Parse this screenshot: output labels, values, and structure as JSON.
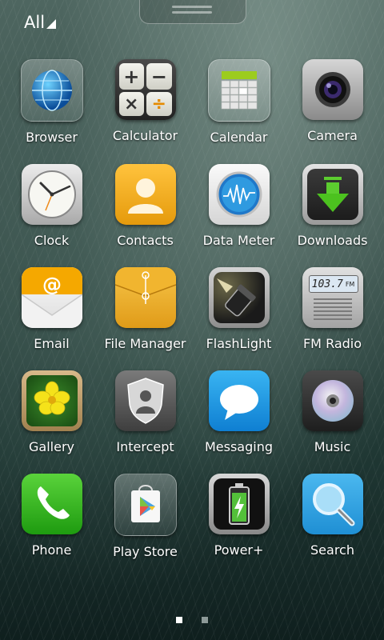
{
  "header": {
    "filter_label": "All"
  },
  "apps": [
    {
      "label": "Browser",
      "icon": "browser-globe-icon"
    },
    {
      "label": "Calculator",
      "icon": "calculator-icon"
    },
    {
      "label": "Calendar",
      "icon": "calendar-icon"
    },
    {
      "label": "Camera",
      "icon": "camera-icon"
    },
    {
      "label": "Clock",
      "icon": "clock-icon"
    },
    {
      "label": "Contacts",
      "icon": "contacts-icon"
    },
    {
      "label": "Data Meter",
      "icon": "data-meter-icon"
    },
    {
      "label": "Downloads",
      "icon": "downloads-icon"
    },
    {
      "label": "Email",
      "icon": "email-icon"
    },
    {
      "label": "File Manager",
      "icon": "file-manager-icon"
    },
    {
      "label": "FlashLight",
      "icon": "flashlight-icon"
    },
    {
      "label": "FM Radio",
      "icon": "fm-radio-icon"
    },
    {
      "label": "Gallery",
      "icon": "gallery-icon"
    },
    {
      "label": "Intercept",
      "icon": "intercept-icon"
    },
    {
      "label": "Messaging",
      "icon": "messaging-icon"
    },
    {
      "label": "Music",
      "icon": "music-icon"
    },
    {
      "label": "Phone",
      "icon": "phone-icon"
    },
    {
      "label": "Play Store",
      "icon": "play-store-icon"
    },
    {
      "label": "Power+",
      "icon": "power-plus-icon"
    },
    {
      "label": "Search",
      "icon": "search-icon"
    }
  ],
  "calculator": {
    "plus": "+",
    "minus": "−",
    "times": "×",
    "divide": "÷"
  },
  "email_symbol": "@",
  "radio_freq": "103.7",
  "radio_unit": "FM",
  "pager": {
    "pages": 2,
    "current": 1
  }
}
